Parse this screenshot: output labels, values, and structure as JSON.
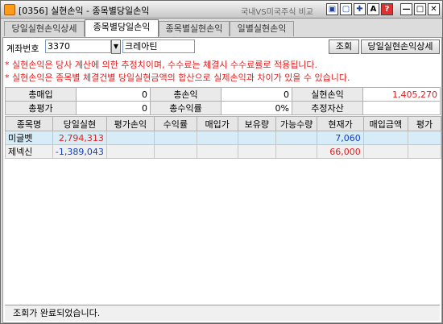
{
  "window": {
    "title": "[0356] 실현손익 - 종목별당일손익",
    "compare_label": "국내VS미국주식 비교"
  },
  "title_buttons": [
    "▣",
    "▢",
    "✚",
    "A",
    "?",
    "—",
    "□",
    "✕"
  ],
  "tabs": [
    "당일실현손익상세",
    "종목별당일손익",
    "종목별실현손익",
    "일별실현손익"
  ],
  "active_tab": 1,
  "account": {
    "label": "계좌번호",
    "number": "3370",
    "name": "크레아틴"
  },
  "buttons": {
    "search": "조회",
    "detail": "당일실현손익상세"
  },
  "notices": [
    "* 실현손익은 당사 계산에 의한 추정치이며, 수수료는 체결시 수수료률로 적용됩니다.",
    "* 실현손익은 종목별 체결건별 당일실현금액의 합산으로 실제손익과 차이가 있을 수 있습니다."
  ],
  "summary": [
    [
      {
        "h": "총매입"
      },
      {
        "v": "0"
      },
      {
        "h": "총손익"
      },
      {
        "v": "0"
      },
      {
        "h": "실현손익"
      },
      {
        "v": "1,405,270",
        "red": true
      }
    ],
    [
      {
        "h": "총평가"
      },
      {
        "v": "0"
      },
      {
        "h": "총수익률"
      },
      {
        "v": "0%"
      },
      {
        "h": "추정자산"
      },
      {
        "v": ""
      }
    ]
  ],
  "grid": {
    "columns": [
      "종목명",
      "당일실현",
      "평가손익",
      "수익률",
      "매입가",
      "보유량",
      "가능수량",
      "현재가",
      "매입금액",
      "평가"
    ],
    "rows": [
      [
        "미글벳",
        "2,794,313",
        "",
        "",
        "",
        "",
        "",
        "7,060",
        "",
        ""
      ],
      [
        "제넥신",
        "-1,389,043",
        "",
        "",
        "",
        "",
        "",
        "66,000",
        "",
        ""
      ]
    ]
  },
  "status": "조회가 완료되었습니다."
}
